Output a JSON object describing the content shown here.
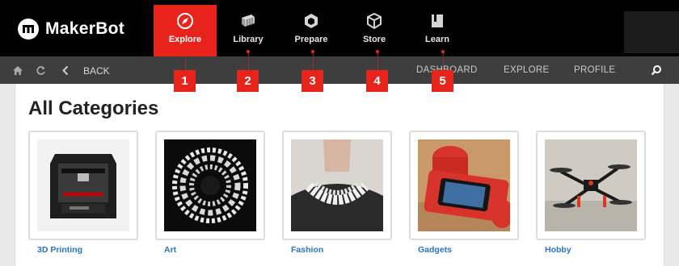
{
  "app": {
    "brand": "MakerBot"
  },
  "nav": {
    "items": [
      {
        "label": "Explore",
        "icon": "compass-icon",
        "active": true
      },
      {
        "label": "Library",
        "icon": "library-icon",
        "active": false
      },
      {
        "label": "Prepare",
        "icon": "prepare-icon",
        "active": false
      },
      {
        "label": "Store",
        "icon": "store-box-icon",
        "active": false
      },
      {
        "label": "Learn",
        "icon": "learn-book-icon",
        "active": false
      }
    ]
  },
  "toolbar": {
    "back_label": "BACK",
    "links": [
      "DASHBOARD",
      "EXPLORE",
      "PROFILE"
    ]
  },
  "callouts": [
    "1",
    "2",
    "3",
    "4",
    "5"
  ],
  "page": {
    "title": "All Categories"
  },
  "categories": [
    {
      "label": "3D Printing"
    },
    {
      "label": "Art"
    },
    {
      "label": "Fashion"
    },
    {
      "label": "Gadgets"
    },
    {
      "label": "Hobby"
    }
  ],
  "colors": {
    "accent": "#e8231c",
    "topbar": "#000000",
    "toolbar": "#3e3e3e",
    "link": "#2a73c9"
  }
}
